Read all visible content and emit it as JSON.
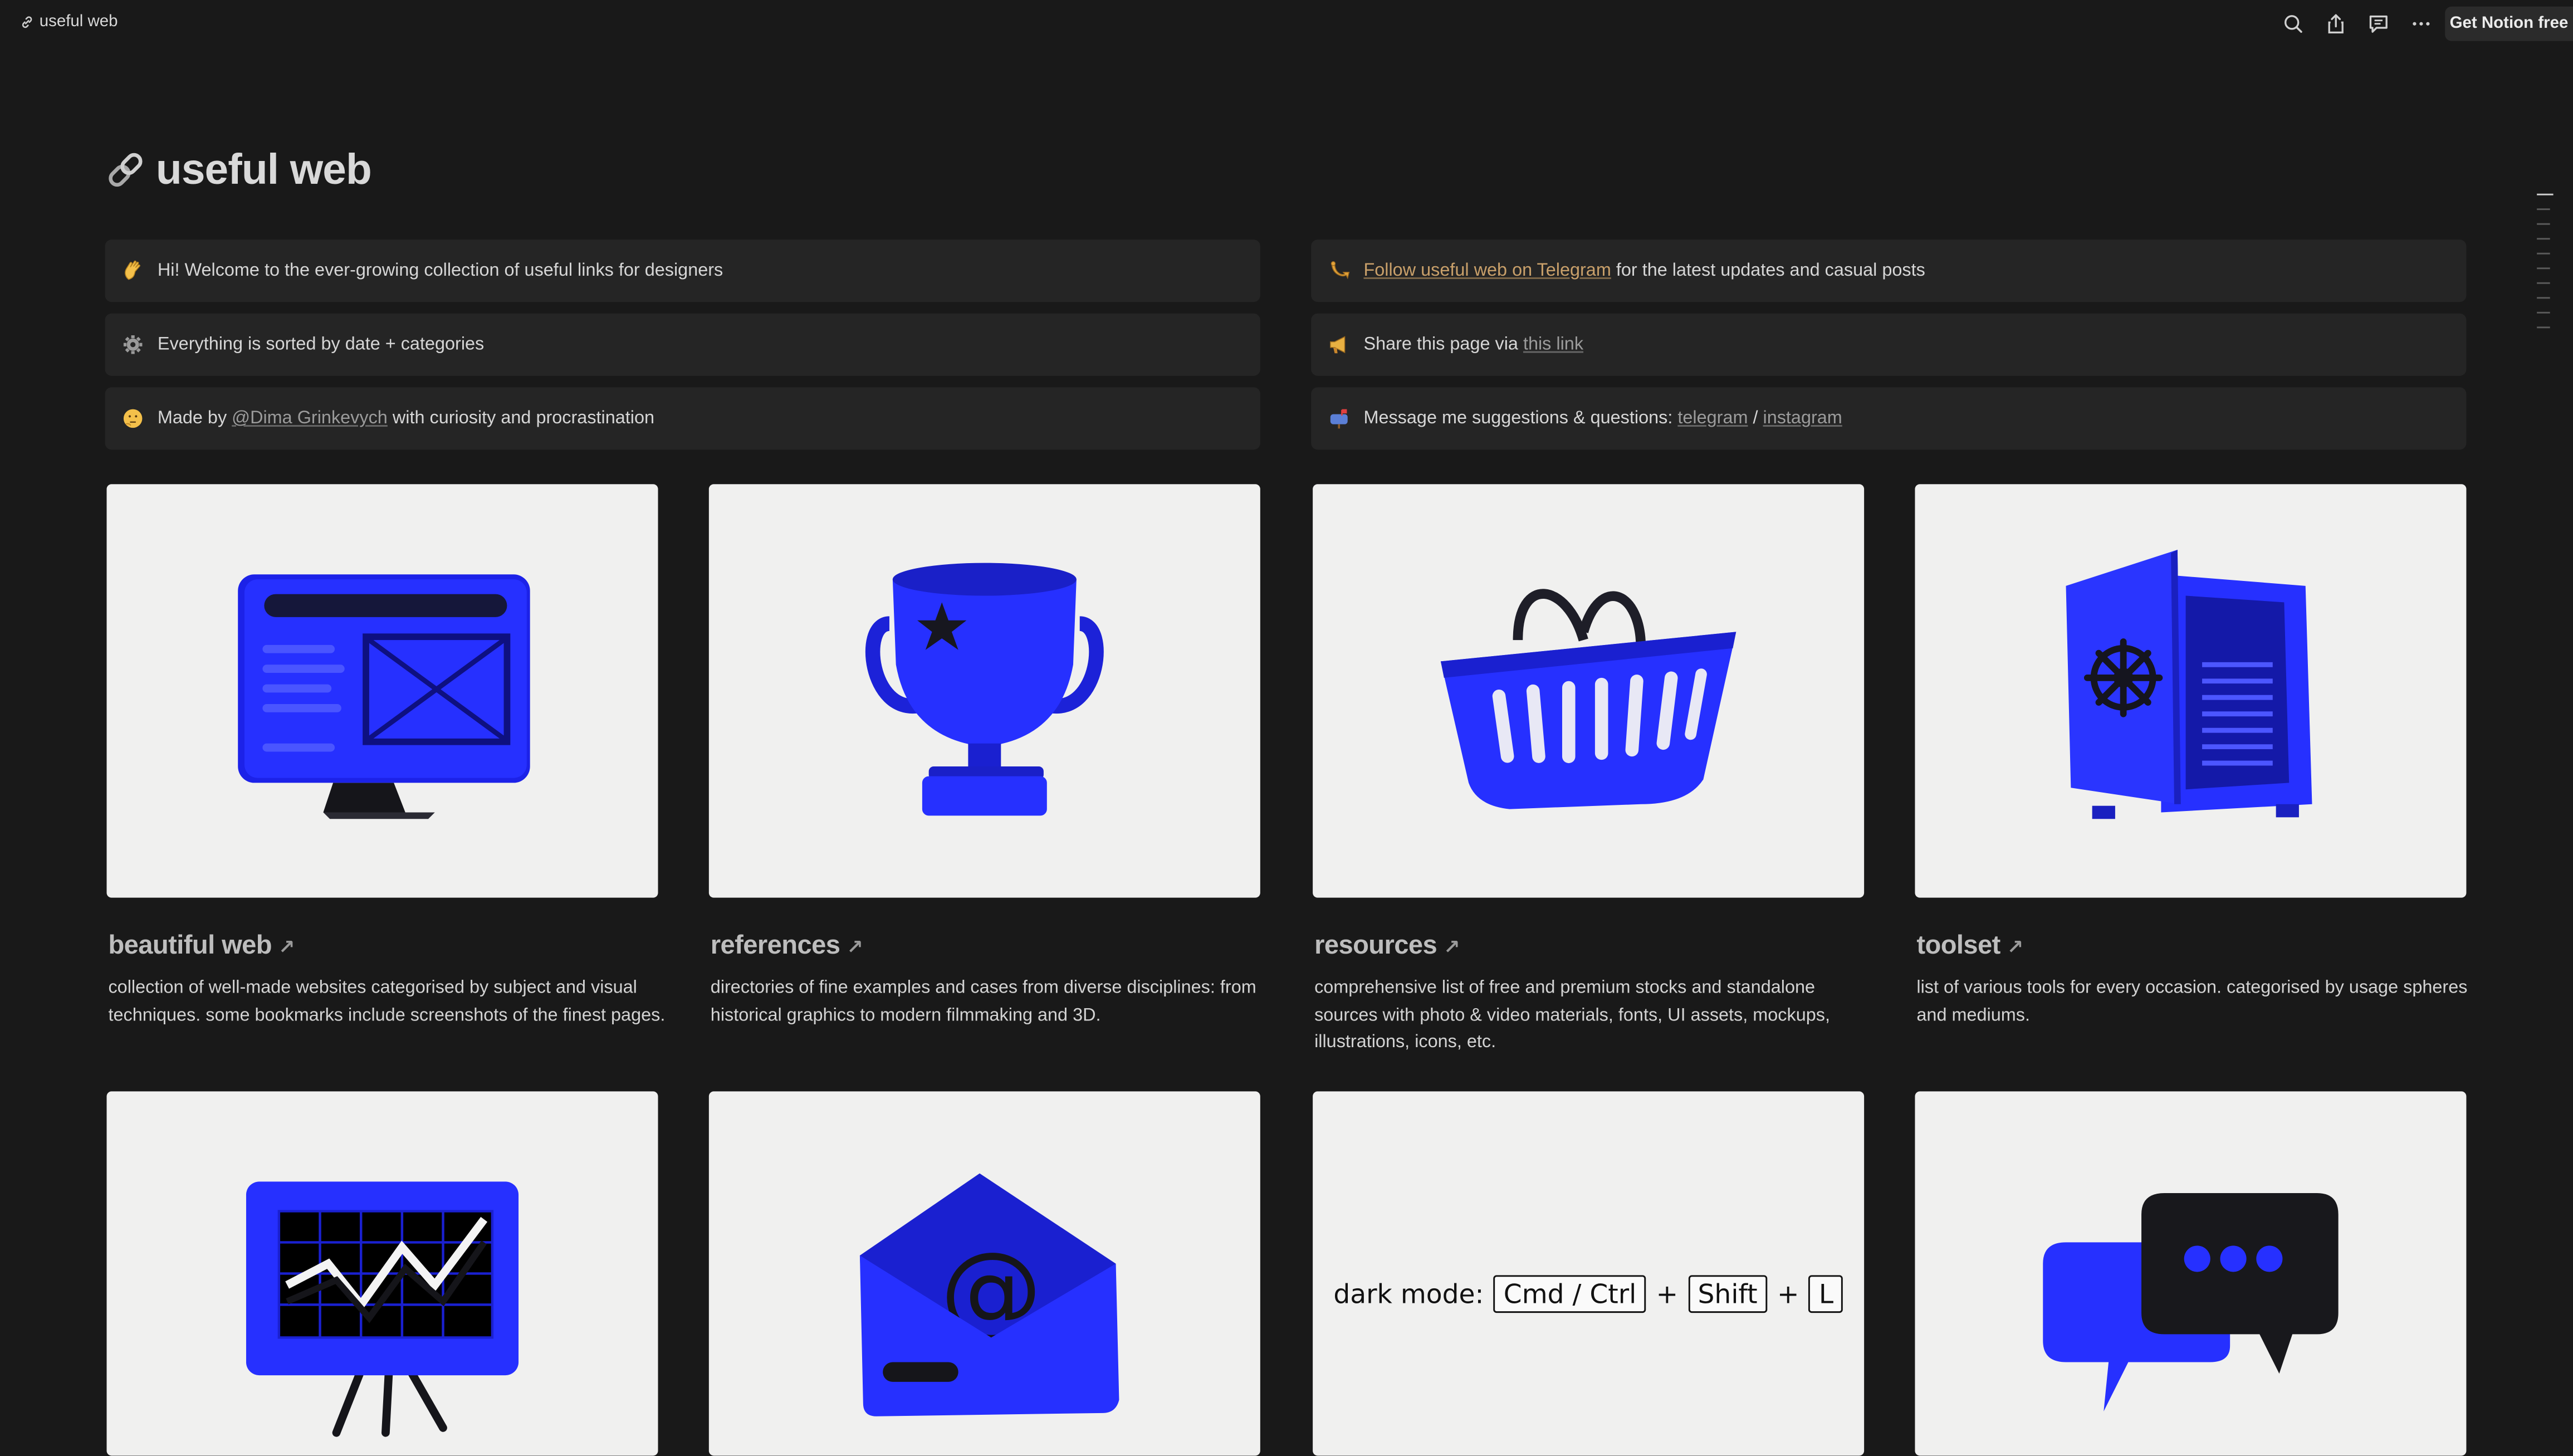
{
  "topbar": {
    "breadcrumb": "useful web",
    "get_notion": "Get Notion free",
    "icons": [
      "search-icon",
      "share-icon",
      "comment-icon",
      "more-icon"
    ]
  },
  "page": {
    "title": "useful web",
    "title_icon": "link-icon"
  },
  "callouts": {
    "left": [
      {
        "icon": "waving-hand-emoji",
        "text": "Hi! Welcome to the ever-growing collection of useful links for designers"
      },
      {
        "icon": "gear-emoji",
        "text": "Everything is sorted by date + categories"
      },
      {
        "icon": "thinking-face-emoji",
        "pre": "Made by ",
        "link": "@Dima Grinkevych",
        "post": " with curiosity and procrastination"
      }
    ],
    "right": [
      {
        "icon": "postal-horn-emoji",
        "link": "Follow useful web on Telegram",
        "post": " for the latest updates and casual posts"
      },
      {
        "icon": "megaphone-emoji",
        "pre": "Share this page via ",
        "link": "this link"
      },
      {
        "icon": "mailbox-emoji",
        "pre": "Message me suggestions & questions: ",
        "link1": "telegram",
        "sep": " / ",
        "link2": "instagram"
      }
    ]
  },
  "cards": [
    {
      "title": "beautiful web",
      "arrow": "↗",
      "description": "collection of well-made websites categorised by subject and visual techniques. some bookmarks include screenshots of the finest pages.",
      "image": "monitor-wireframe-3d"
    },
    {
      "title": "references",
      "arrow": "↗",
      "description": "directories of fine examples and cases from diverse disciplines: from historical graphics to modern filmmaking and 3D.",
      "image": "trophy-3d"
    },
    {
      "title": "resources",
      "arrow": "↗",
      "description": "comprehensive list of free and premium stocks and standalone sources with photo & video materials, fonts, UI assets, mockups, illustrations, icons, etc.",
      "image": "shopping-basket-3d"
    },
    {
      "title": "toolset",
      "arrow": "↗",
      "description": "list of various tools for every occasion. categorised by usage spheres and mediums.",
      "image": "safe-3d"
    }
  ],
  "row2": {
    "images": [
      "presentation-board-3d",
      "envelope-at-3d",
      "dark-mode-shortcut",
      "chat-bubbles-3d"
    ],
    "dark_mode": {
      "label": "dark mode:",
      "key1": "Cmd / Ctrl",
      "plus": "+",
      "key2": "Shift",
      "key3": "L"
    }
  },
  "colors": {
    "background": "#191919",
    "callout": "#252525",
    "card": "#f0f0ef",
    "blue": "#1f2bff",
    "link_gold": "#c9a06a"
  }
}
